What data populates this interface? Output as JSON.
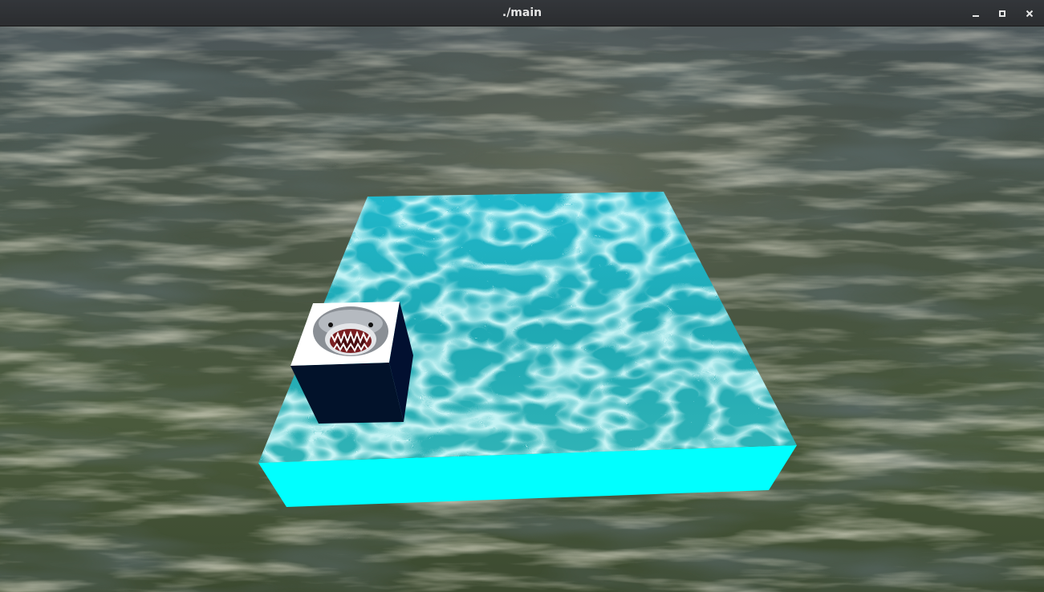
{
  "window": {
    "title": "./main",
    "controls": {
      "minimize": "minimize-icon",
      "maximize": "maximize-icon",
      "close": "close-icon"
    }
  },
  "scene": {
    "background": "ocean-terrain",
    "objects": [
      {
        "name": "water-slab",
        "texture": "water-caustics",
        "side_color": "#00ffff"
      },
      {
        "name": "shark-cube",
        "texture": "shark-face",
        "side_color": "#02122a"
      }
    ],
    "colors": {
      "sea_dark": "#3c4a3e",
      "sea_light": "#c9c5a8",
      "water_top": "#2ab7c4",
      "water_side": "#00ffff",
      "cube_side": "#02122a"
    }
  }
}
